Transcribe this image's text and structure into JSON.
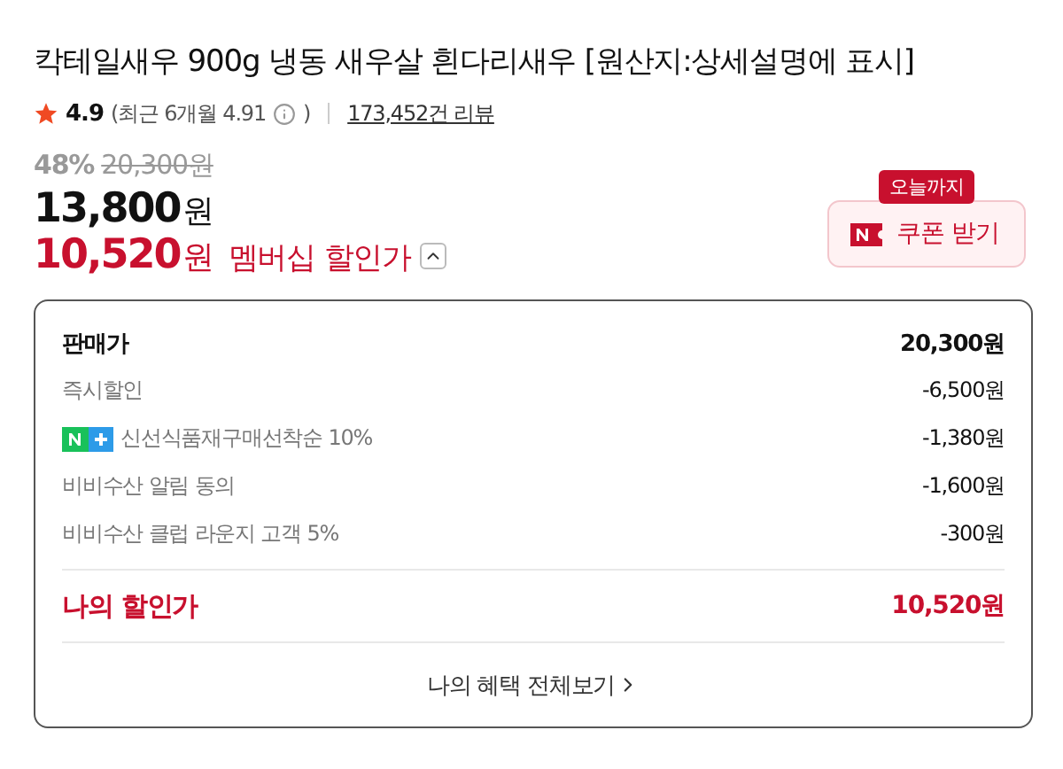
{
  "product": {
    "title": "칵테일새우 900g 냉동 새우살 흰다리새우 [원산지:상세설명에 표시]"
  },
  "rating": {
    "score": "4.9",
    "recent": "(최근 6개월 4.91",
    "recent_close": ")",
    "reviews": "173,452건 리뷰"
  },
  "price": {
    "discount_rate": "48%",
    "original": "20,300원",
    "sale_amount": "13,800",
    "sale_unit": "원",
    "member_amount": "10,520",
    "member_unit": "원",
    "member_label": "멤버십 할인가",
    "member_expanded": true
  },
  "coupon": {
    "badge": "오늘까지",
    "label": "쿠폰 받기"
  },
  "breakdown": {
    "rows": [
      {
        "kind": "total",
        "label": "판매가",
        "value": "20,300원"
      },
      {
        "kind": "plain",
        "label": "즉시할인",
        "value": "-6,500원"
      },
      {
        "kind": "membership",
        "label": "신선식품재구매선착순 10%",
        "value": "-1,380원"
      },
      {
        "kind": "plain",
        "label": "비비수산 알림 동의",
        "value": "-1,600원"
      },
      {
        "kind": "plain",
        "label": "비비수산 클럽 라운지 고객 5%",
        "value": "-300원"
      }
    ],
    "final": {
      "label": "나의 할인가",
      "value": "10,520원"
    },
    "link": "나의 혜택 전체보기"
  }
}
